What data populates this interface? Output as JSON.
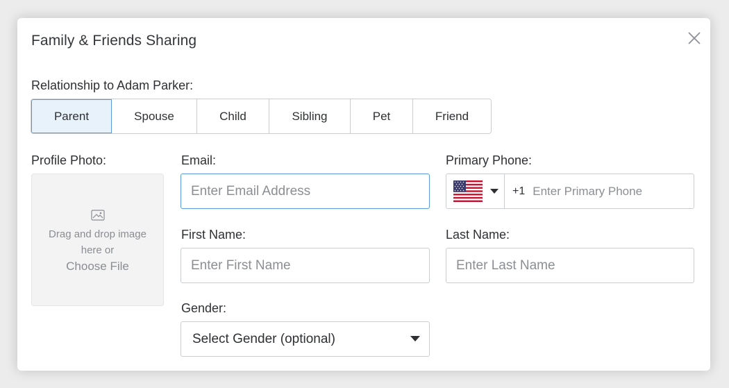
{
  "dialog": {
    "title": "Family & Friends Sharing",
    "close_icon": "close-icon"
  },
  "relationship": {
    "label": "Relationship to Adam Parker:",
    "options": [
      "Parent",
      "Spouse",
      "Child",
      "Sibling",
      "Pet",
      "Friend"
    ],
    "selected": "Parent"
  },
  "profile_photo": {
    "label": "Profile Photo:",
    "icon": "image-icon",
    "drop_text": "Drag and drop image here or",
    "choose_link": "Choose File"
  },
  "email": {
    "label": "Email:",
    "placeholder": "Enter Email Address",
    "value": ""
  },
  "primary_phone": {
    "label": "Primary Phone:",
    "country_icon": "us-flag-icon",
    "country_code": "+1",
    "placeholder": "Enter Primary Phone"
  },
  "first_name": {
    "label": "First Name:",
    "placeholder": "Enter First Name"
  },
  "last_name": {
    "label": "Last Name:",
    "placeholder": "Enter Last Name"
  },
  "gender": {
    "label": "Gender:",
    "selected": "Select Gender (optional)"
  },
  "colors": {
    "accent_border": "#5b9bd5",
    "active_bg": "#e8f2fb"
  }
}
